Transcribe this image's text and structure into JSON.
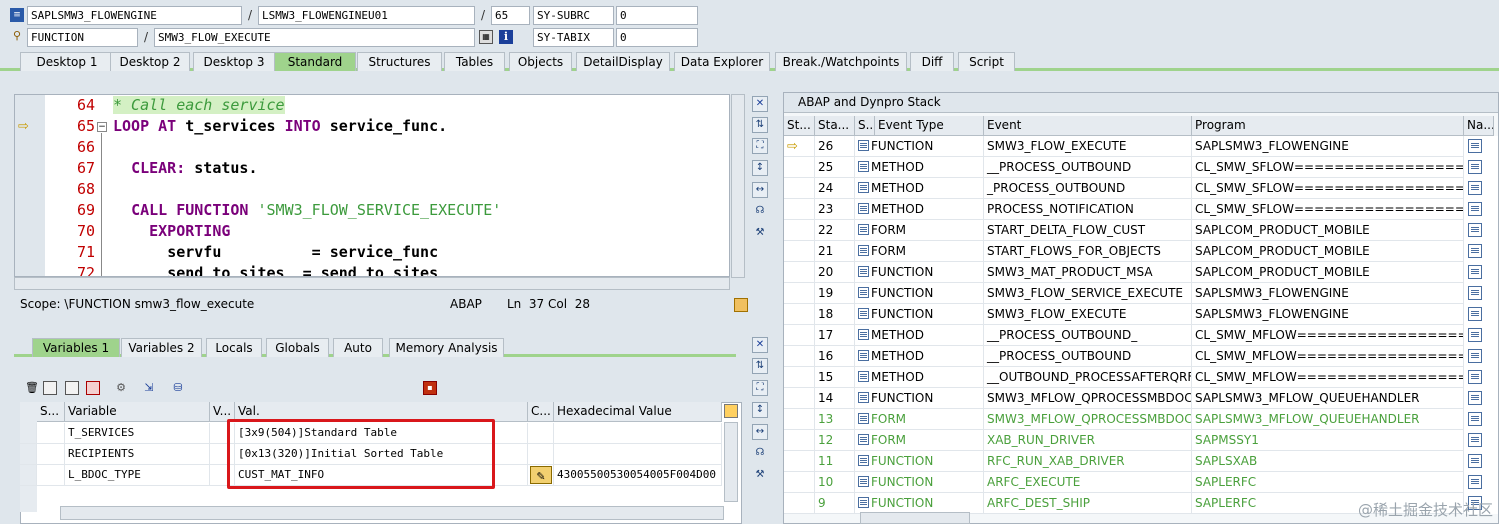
{
  "header": {
    "program": "SAPLSMW3_FLOWENGINE",
    "include": "LSMW3_FLOWENGINEU01",
    "line": "65",
    "sy_subrc_label": "SY-SUBRC",
    "sy_subrc_value": "0",
    "event_type": "FUNCTION",
    "event_name": "SMW3_FLOW_EXECUTE",
    "sy_tabix_label": "SY-TABIX",
    "sy_tabix_value": "0"
  },
  "tabs": [
    "Desktop 1",
    "Desktop 2",
    "Desktop 3",
    "Standard",
    "Structures",
    "Tables",
    "Objects",
    "DetailDisplay",
    "Data Explorer",
    "Break./Watchpoints",
    "Diff",
    "Script"
  ],
  "editor": {
    "lines": [
      {
        "no": "64",
        "html": "<span class=\"c\">* Call each service</span>"
      },
      {
        "no": "65",
        "html": "<span class=\"k\">LOOP AT</span> <span class=\"v\">t_services</span> <span class=\"k\">INTO</span> <span class=\"v\">service_func.</span>"
      },
      {
        "no": "66",
        "html": ""
      },
      {
        "no": "67",
        "html": "  <span class=\"k\">CLEAR:</span> <span class=\"v\">status.</span>"
      },
      {
        "no": "68",
        "html": ""
      },
      {
        "no": "69",
        "html": "  <span class=\"k\">CALL FUNCTION</span> <span class=\"s\">'SMW3_FLOW_SERVICE_EXECUTE'</span>"
      },
      {
        "no": "70",
        "html": "    <span class=\"k\">EXPORTING</span>"
      },
      {
        "no": "71",
        "html": "      <span class=\"v\">servfu          = service_func</span>"
      },
      {
        "no": "72",
        "html": "      <span class=\"v\">send_to_sites  = send_to_sites</span>"
      }
    ],
    "scope": "Scope: \\FUNCTION smw3_flow_execute",
    "lang": "ABAP",
    "pos": "Ln  37 Col  28"
  },
  "var_tabs": [
    "Variables 1",
    "Variables 2",
    "Locals",
    "Globals",
    "Auto",
    "Memory Analysis"
  ],
  "var_grid": {
    "headers": [
      "S...",
      "Variable",
      "V...",
      "Val.",
      "C...",
      "Hexadecimal Value"
    ],
    "rows": [
      {
        "variable": "T_SERVICES",
        "value": "[3x9(504)]Standard Table",
        "hex": ""
      },
      {
        "variable": "RECIPIENTS",
        "value": "[0x13(320)]Initial Sorted Table",
        "hex": ""
      },
      {
        "variable": "L_BDOC_TYPE",
        "value": "CUST_MAT_INFO",
        "hex": "43005500530054005F004D00"
      }
    ]
  },
  "stack": {
    "title": "ABAP and Dynpro Stack",
    "headers": [
      "St...",
      "Sta...",
      "S...",
      "Event Type",
      "Event",
      "Program",
      "Na..."
    ],
    "rows": [
      {
        "level": "26",
        "type": "FUNCTION",
        "event": "SMW3_FLOW_EXECUTE",
        "program": "SAPLSMW3_FLOWENGINE",
        "current": true,
        "green": false
      },
      {
        "level": "25",
        "type": "METHOD",
        "event": "__PROCESS_OUTBOUND",
        "program": "CL_SMW_SFLOW==================C...",
        "current": false,
        "green": false
      },
      {
        "level": "24",
        "type": "METHOD",
        "event": "_PROCESS_OUTBOUND",
        "program": "CL_SMW_SFLOW==================C...",
        "current": false,
        "green": false
      },
      {
        "level": "23",
        "type": "METHOD",
        "event": "PROCESS_NOTIFICATION",
        "program": "CL_SMW_SFLOW==================C...",
        "current": false,
        "green": false
      },
      {
        "level": "22",
        "type": "FORM",
        "event": "START_DELTA_FLOW_CUST",
        "program": "SAPLCOM_PRODUCT_MOBILE",
        "current": false,
        "green": false
      },
      {
        "level": "21",
        "type": "FORM",
        "event": "START_FLOWS_FOR_OBJECTS",
        "program": "SAPLCOM_PRODUCT_MOBILE",
        "current": false,
        "green": false
      },
      {
        "level": "20",
        "type": "FUNCTION",
        "event": "SMW3_MAT_PRODUCT_MSA",
        "program": "SAPLCOM_PRODUCT_MOBILE",
        "current": false,
        "green": false
      },
      {
        "level": "19",
        "type": "FUNCTION",
        "event": "SMW3_FLOW_SERVICE_EXECUTE",
        "program": "SAPLSMW3_FLOWENGINE",
        "current": false,
        "green": false
      },
      {
        "level": "18",
        "type": "FUNCTION",
        "event": "SMW3_FLOW_EXECUTE",
        "program": "SAPLSMW3_FLOWENGINE",
        "current": false,
        "green": false
      },
      {
        "level": "17",
        "type": "METHOD",
        "event": "__PROCESS_OUTBOUND_",
        "program": "CL_SMW_MFLOW=================...",
        "current": false,
        "green": false
      },
      {
        "level": "16",
        "type": "METHOD",
        "event": "__PROCESS_OUTBOUND",
        "program": "CL_SMW_MFLOW=================...",
        "current": false,
        "green": false
      },
      {
        "level": "15",
        "type": "METHOD",
        "event": "__OUTBOUND_PROCESSAFTERQRFC",
        "program": "CL_SMW_MFLOW=================...",
        "current": false,
        "green": false
      },
      {
        "level": "14",
        "type": "FUNCTION",
        "event": "SMW3_MFLOW_QPROCESSMBDOC",
        "program": "SAPLSMW3_MFLOW_QUEUEHANDLER",
        "current": false,
        "green": false
      },
      {
        "level": "13",
        "type": "FORM",
        "event": "SMW3_MFLOW_QPROCESSMBDOC",
        "program": "SAPLSMW3_MFLOW_QUEUEHANDLER",
        "current": false,
        "green": true
      },
      {
        "level": "12",
        "type": "FORM",
        "event": "XAB_RUN_DRIVER",
        "program": "SAPMSSY1",
        "current": false,
        "green": true
      },
      {
        "level": "11",
        "type": "FUNCTION",
        "event": "RFC_RUN_XAB_DRIVER",
        "program": "SAPLSXAB",
        "current": false,
        "green": true
      },
      {
        "level": "10",
        "type": "FUNCTION",
        "event": "ARFC_EXECUTE",
        "program": "SAPLERFC",
        "current": false,
        "green": true
      },
      {
        "level": "9",
        "type": "FUNCTION",
        "event": "ARFC_DEST_SHIP",
        "program": "SAPLERFC",
        "current": false,
        "green": true
      }
    ]
  },
  "watermark": "@稀土掘金技术社区"
}
